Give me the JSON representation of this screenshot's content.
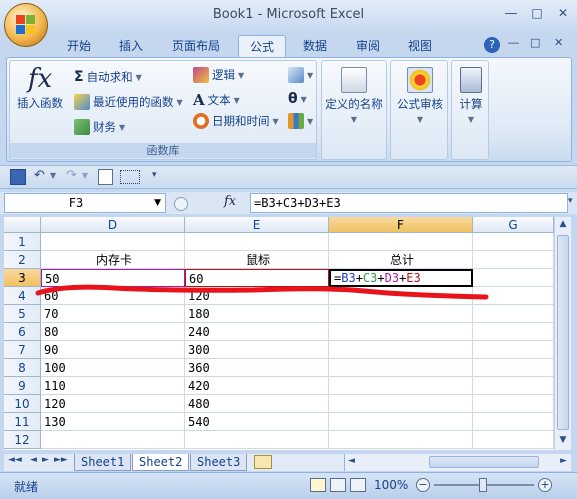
{
  "window": {
    "title": "Book1 - Microsoft Excel",
    "controls": [
      "minimize",
      "maximize",
      "close"
    ]
  },
  "ribbon_tabs": [
    {
      "label": "开始",
      "active": false
    },
    {
      "label": "插入",
      "active": false
    },
    {
      "label": "页面布局",
      "active": false
    },
    {
      "label": "公式",
      "active": true
    },
    {
      "label": "数据",
      "active": false
    },
    {
      "label": "审阅",
      "active": false
    },
    {
      "label": "视图",
      "active": false
    }
  ],
  "ribbon": {
    "insert_function": "插入函数",
    "autosum": "自动求和",
    "recent": "最近使用的函数",
    "financial": "财务",
    "logical": "逻辑",
    "text": "文本",
    "datetime": "日期和时间",
    "function_library_label": "函数库",
    "defined_names": "定义的名称",
    "formula_auditing": "公式审核",
    "calculation": "计算"
  },
  "formula_bar": {
    "name_box": "F3",
    "fx_label": "fx",
    "formula": "=B3+C3+D3+E3"
  },
  "grid": {
    "columns": [
      "D",
      "E",
      "F",
      "G"
    ],
    "selected_column": "F",
    "selected_row": 3,
    "rows": [
      {
        "n": "1",
        "D": "",
        "E": "",
        "F": ""
      },
      {
        "n": "2",
        "D": "内存卡",
        "E": "鼠标",
        "F": "总计"
      },
      {
        "n": "3",
        "D": "50",
        "E": "60",
        "F": "=B3+C3+D3+E3"
      },
      {
        "n": "4",
        "D": "60",
        "E": "120",
        "F": ""
      },
      {
        "n": "5",
        "D": "70",
        "E": "180",
        "F": ""
      },
      {
        "n": "6",
        "D": "80",
        "E": "240",
        "F": ""
      },
      {
        "n": "7",
        "D": "90",
        "E": "300",
        "F": ""
      },
      {
        "n": "8",
        "D": "100",
        "E": "360",
        "F": ""
      },
      {
        "n": "9",
        "D": "110",
        "E": "420",
        "F": ""
      },
      {
        "n": "10",
        "D": "120",
        "E": "480",
        "F": ""
      },
      {
        "n": "11",
        "D": "130",
        "E": "540",
        "F": ""
      },
      {
        "n": "12",
        "D": "",
        "E": "",
        "F": ""
      }
    ],
    "formula_parts": [
      {
        "t": "=",
        "color": "#000000"
      },
      {
        "t": "B3",
        "color": "#1f3fbf"
      },
      {
        "t": "+",
        "color": "#000000"
      },
      {
        "t": "C3",
        "color": "#2a9d3a"
      },
      {
        "t": "+",
        "color": "#000000"
      },
      {
        "t": "D3",
        "color": "#a01f9f"
      },
      {
        "t": "+",
        "color": "#000000"
      },
      {
        "t": "E3",
        "color": "#b5121b"
      }
    ]
  },
  "sheet_tabs": [
    {
      "label": "Sheet1",
      "active": false
    },
    {
      "label": "Sheet2",
      "active": true
    },
    {
      "label": "Sheet3",
      "active": false
    }
  ],
  "status": {
    "ready": "就绪",
    "zoom": "100%"
  },
  "colors": {
    "annotation_red": "#e8141b",
    "accent": "#15428b"
  }
}
